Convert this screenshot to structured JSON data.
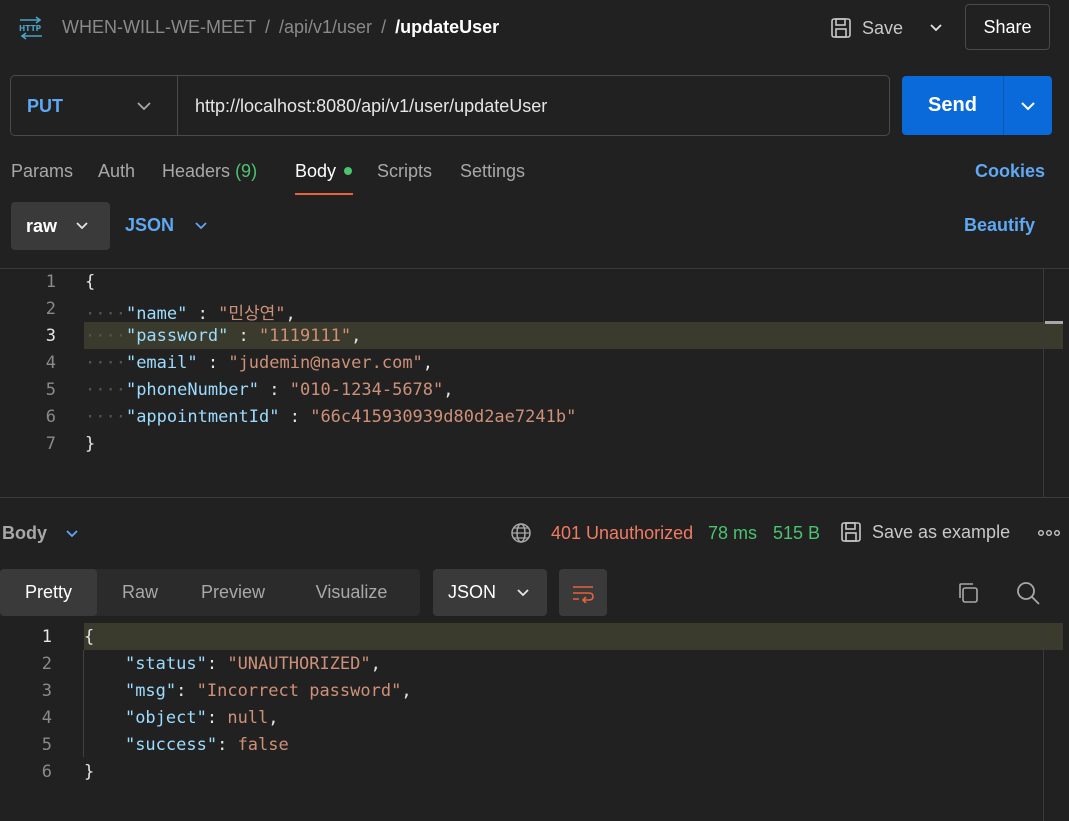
{
  "header": {
    "breadcrumb": [
      "WHEN-WILL-WE-MEET",
      "/api/v1/user",
      "/updateUser"
    ],
    "save_label": "Save",
    "share_label": "Share"
  },
  "request": {
    "method": "PUT",
    "url": "http://localhost:8080/api/v1/user/updateUser",
    "send_label": "Send"
  },
  "tabs": {
    "params": "Params",
    "auth": "Auth",
    "headers": "Headers",
    "headers_count": "(9)",
    "body": "Body",
    "scripts": "Scripts",
    "settings": "Settings",
    "cookies": "Cookies"
  },
  "body_mode": {
    "mode": "raw",
    "type": "JSON",
    "beautify": "Beautify"
  },
  "request_body": {
    "line_numbers": [
      "1",
      "2",
      "3",
      "4",
      "5",
      "6",
      "7"
    ],
    "open_brace": "{",
    "close_brace": "}",
    "fields": [
      {
        "key": "\"name\"",
        "value": "\"민상연\"",
        "trail": ","
      },
      {
        "key": "\"password\"",
        "value": "\"1119111\"",
        "trail": ","
      },
      {
        "key": "\"email\"",
        "value": "\"judemin@naver.com\"",
        "trail": ","
      },
      {
        "key": "\"phoneNumber\"",
        "value": "\"010-1234-5678\"",
        "trail": ","
      },
      {
        "key": "\"appointmentId\"",
        "value": "\"66c415930939d80d2ae7241b\"",
        "trail": ""
      }
    ]
  },
  "response": {
    "body_label": "Body",
    "status": "401 Unauthorized",
    "time": "78 ms",
    "size": "515 B",
    "save_example": "Save as example",
    "tabs": [
      "Pretty",
      "Raw",
      "Preview",
      "Visualize"
    ],
    "format": "JSON",
    "line_numbers": [
      "1",
      "2",
      "3",
      "4",
      "5",
      "6"
    ],
    "open_brace": "{",
    "close_brace": "}",
    "fields": [
      {
        "key": "\"status\"",
        "value": "\"UNAUTHORIZED\"",
        "trail": ","
      },
      {
        "key": "\"msg\"",
        "value": "\"Incorrect password\"",
        "trail": ","
      },
      {
        "key": "\"object\"",
        "value": "null",
        "trail": ","
      },
      {
        "key": "\"success\"",
        "value": "false",
        "trail": ""
      }
    ]
  },
  "colors": {
    "accent": "#0b6ad9",
    "link": "#5fa8f3",
    "success": "#4cc36f",
    "error": "#f07b63",
    "json_key": "#9cdcfe",
    "json_string": "#ce9178"
  }
}
